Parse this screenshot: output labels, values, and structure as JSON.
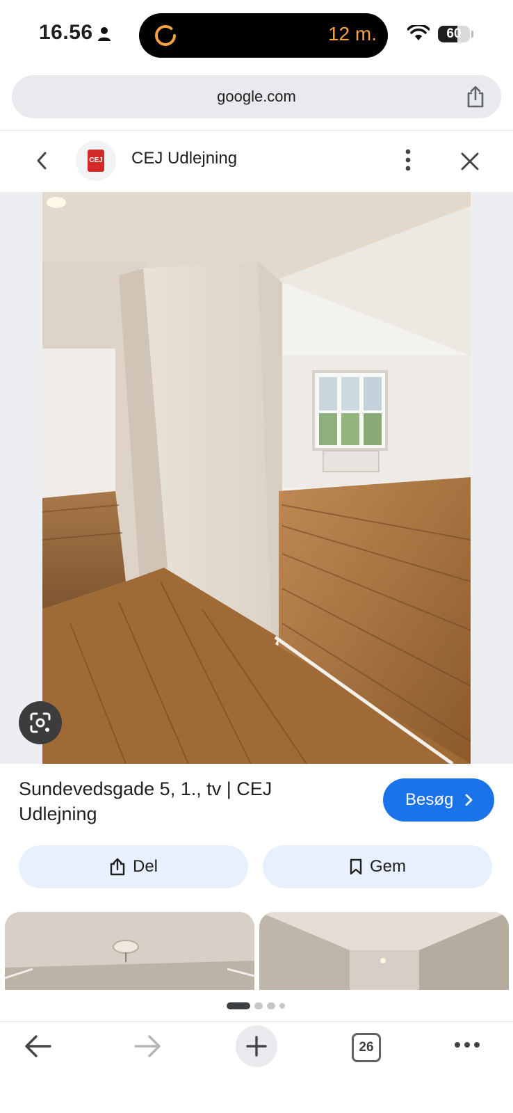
{
  "status_bar": {
    "time": "16.56",
    "island_timer": "12 m.",
    "battery": "60",
    "battery_fraction": 0.6,
    "icons": [
      "person-icon",
      "ring-timer-icon",
      "wifi-icon",
      "battery-icon"
    ]
  },
  "browser": {
    "url": "google.com",
    "tab_count": "26"
  },
  "header": {
    "site_name": "CEJ Udlejning",
    "logo_text": "CEJ"
  },
  "result": {
    "title": "Sundevedsgade 5, 1., tv | CEJ Udlejning",
    "visit_label": "Besøg",
    "share_label": "Del",
    "save_label": "Gem"
  },
  "pager": {
    "dots": 4,
    "active_index": 0
  },
  "colors": {
    "accent": "#1a73e8",
    "action_bg": "#e8f0fe",
    "island_text": "#f5a142",
    "logo_red": "#d42a2a"
  }
}
